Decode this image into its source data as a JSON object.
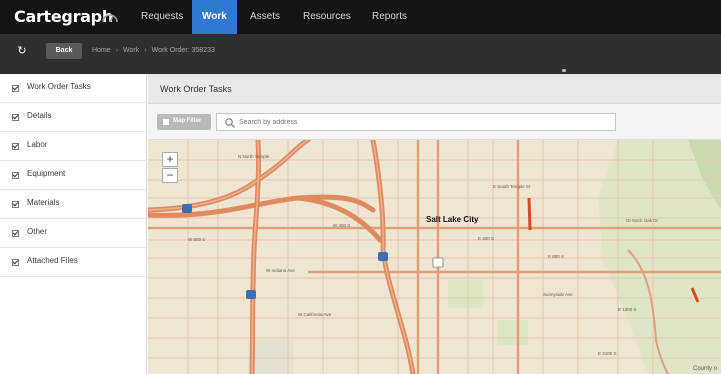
{
  "app": {
    "logo": "Cartegraph",
    "nav": [
      {
        "label": "Requests",
        "active": false
      },
      {
        "label": "Work",
        "active": true
      },
      {
        "label": "Assets",
        "active": false
      },
      {
        "label": "Resources",
        "active": false
      },
      {
        "label": "Reports",
        "active": false
      }
    ],
    "accent_color": "#2f79d4"
  },
  "breadcrumb": {
    "back_label": "Back",
    "items": [
      "Home",
      "Work",
      "Work Order: 358233"
    ]
  },
  "sidebar": {
    "items": [
      {
        "label": "Work Order Tasks",
        "checked": true
      },
      {
        "label": "Details",
        "checked": true
      },
      {
        "label": "Labor",
        "checked": true
      },
      {
        "label": "Equipment",
        "checked": true
      },
      {
        "label": "Materials",
        "checked": true
      },
      {
        "label": "Other",
        "checked": true
      },
      {
        "label": "Attached Files",
        "checked": true
      }
    ]
  },
  "panel": {
    "title": "Work Order Tasks",
    "map_filter_label": "Map Filter",
    "search_placeholder": "Search by address"
  },
  "map": {
    "zoom_in": "+",
    "zoom_out": "−",
    "city": "Salt Lake City",
    "attribution": "County o",
    "road_labels": [
      "N North Temple",
      "W 400 S",
      "W 800 S",
      "W Indiana Ave",
      "W California Ave",
      "E 400 S",
      "E 800 S",
      "E 1300 S",
      "E 2100 S",
      "E South Temple St",
      "Sunnyside Ave",
      "Gr Neck Oak Dr"
    ],
    "shields": [
      "80",
      "215",
      "15",
      "89"
    ]
  }
}
